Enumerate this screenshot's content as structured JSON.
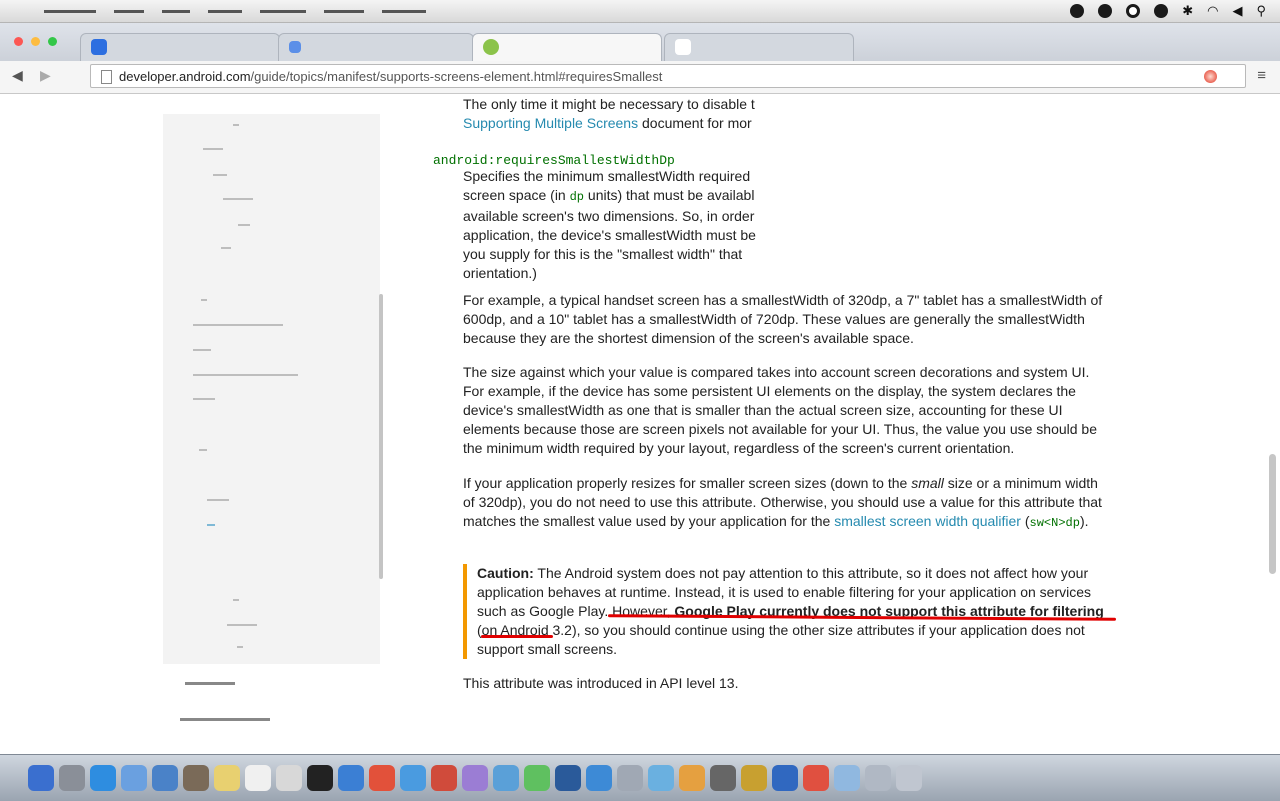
{
  "browser": {
    "address": {
      "host": "developer.android.com",
      "path": "/guide/topics/manifest/supports-screens-element.html#requiresSmallest"
    },
    "nav_back": "◀",
    "nav_forward": "▶",
    "menu_glyph": "≡"
  },
  "article": {
    "intro_line1_a": "The only time it might be necessary to disable t",
    "intro_link": "Supporting Multiple Screens",
    "intro_line2_b": " document for mor",
    "attribute_name": "android:requiresSmallestWidthDp",
    "desc": {
      "l1": "Specifies the minimum smallestWidth required",
      "l2a": "screen space (in ",
      "l2code": "dp",
      "l2b": " units) that must be availabl",
      "l3": "available screen's two dimensions. So, in order",
      "l4": "application, the device's smallestWidth must be",
      "l5": "you supply for this is the \"smallest width\" that",
      "l6": "orientation.)"
    },
    "para_example": "For example, a typical handset screen has a smallestWidth of 320dp, a 7\" tablet has a smallestWidth of 600dp, and a 10\" tablet has a smallestWidth of 720dp. These values are generally the smallestWidth because they are the shortest dimension of the screen's available space.",
    "para_size": "The size against which your value is compared takes into account screen decorations and system UI. For example, if the device has some persistent UI elements on the display, the system declares the device's smallestWidth as one that is smaller than the actual screen size, accounting for these UI elements because those are screen pixels not available for your UI. Thus, the value you use should be the minimum width required by your layout, regardless of the screen's current orientation.",
    "para_resize_a": "If your application properly resizes for smaller screen sizes (down to the ",
    "para_resize_em": "small",
    "para_resize_b": " size or a minimum width of 320dp), you do not need to use this attribute. Otherwise, you should use a value for this attribute that matches the smallest value used by your application for the ",
    "para_resize_link": "smallest screen width qualifier",
    "para_resize_c": " (",
    "para_resize_code": "sw<N>dp",
    "para_resize_d": ").",
    "caution_label": "Caution:",
    "caution_a": " The Android system does not pay attention to this attribute, so it does not affect how your application behaves at runtime. Instead, it is used to enable filtering for your application on services such as Google Play. However, ",
    "caution_bold": "Google Play currently does not support this attribute for filtering",
    "caution_b": " (on Android 3.2), so you should continue using the other size attributes if your application does not support small screens.",
    "api_note": "This attribute was introduced in API level 13."
  },
  "colors": {
    "link": "#258aaf",
    "code": "#007000",
    "caution_bar": "#f39800",
    "annotation_red": "#e00000"
  }
}
